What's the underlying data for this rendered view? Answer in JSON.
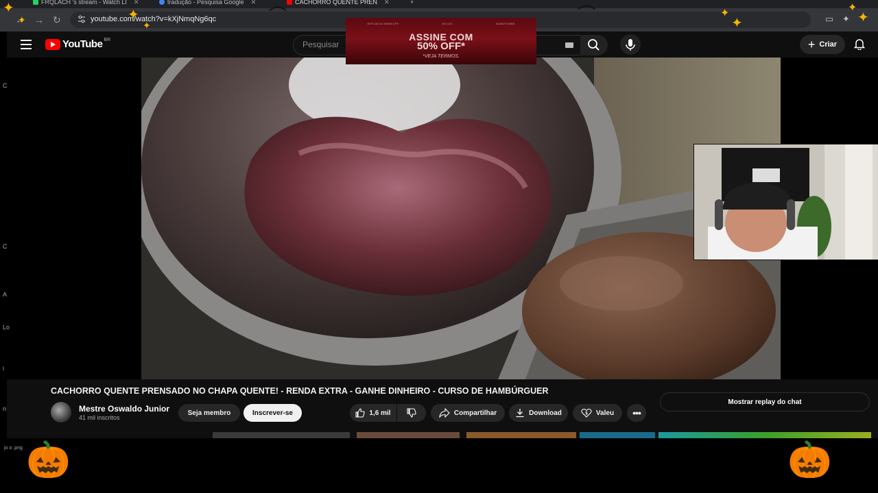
{
  "browser": {
    "tabs": [
      {
        "label": "FRQLACH 's stream - Watch LI"
      },
      {
        "label": "tradução - Pesquisa Google"
      },
      {
        "label": "CACHORRO QUENTE PREN"
      }
    ],
    "url": "youtube.com/watch?v=kXjNmqNg6qc"
  },
  "header": {
    "logo_text": "YouTube",
    "region": "BR",
    "search_placeholder": "Pesquisar",
    "create_label": "Criar"
  },
  "ad": {
    "line1": "ASSINE COM",
    "line2": "50% OFF*",
    "line3": "*VEJA TERMOS.",
    "fine_print": [
      "EXITLAO AL MAWN CPS",
      "NO LAG",
      "ALWAYS WINS"
    ]
  },
  "left_edge_letters": [
    "C",
    "C",
    "A",
    "Lo",
    "i",
    "n"
  ],
  "video": {
    "title": "CACHORRO QUENTE PRENSADO NO CHAPA QUENTE! - RENDA EXTRA - GANHE DINHEIRO - CURSO DE HAMBÚRGUER"
  },
  "channel": {
    "name": "Mestre Oswaldo Junior",
    "subscribers": "41 mil inscritos",
    "member_label": "Seja membro",
    "subscribe_label": "Inscrever-se"
  },
  "actions": {
    "likes": "1,6 mil",
    "share": "Compartilhar",
    "download": "Download",
    "thanks": "Valeu"
  },
  "chat": {
    "replay_label": "Mostrar replay do chat"
  },
  "overlay": {
    "filename": "jo  o .png"
  },
  "colors": {
    "youtube_red": "#ff0000",
    "page_bg": "#0f0f0f",
    "accent_gold": "#f7b500",
    "pumpkin_orange": "#f28a12"
  }
}
